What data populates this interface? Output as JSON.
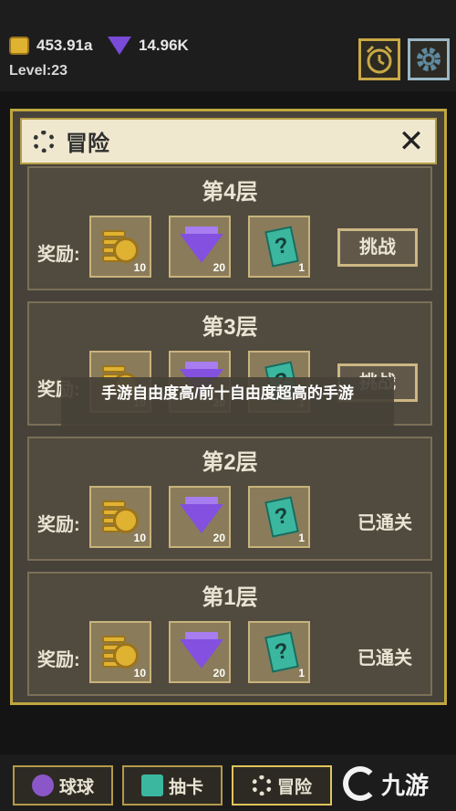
{
  "top": {
    "coins": "453.91a",
    "gems": "14.96K",
    "level": "Level:23"
  },
  "dialog": {
    "title": "冒险",
    "reward_label": "奖励:",
    "floors": [
      {
        "title": "第4层",
        "rewards": {
          "coins": "10",
          "gems": "20",
          "cards": "1"
        },
        "action": "挑战"
      },
      {
        "title": "第3层",
        "rewards": {
          "coins": "10",
          "gems": "20",
          "cards": "1"
        },
        "action": "挑战"
      },
      {
        "title": "第2层",
        "rewards": {
          "coins": "10",
          "gems": "20",
          "cards": "1"
        },
        "status": "已通关"
      },
      {
        "title": "第1层",
        "rewards": {
          "coins": "10",
          "gems": "20",
          "cards": "1"
        },
        "status": "已通关"
      }
    ]
  },
  "banner": "手游自由度高/前十自由度超高的手游",
  "tabs": {
    "ball": "球球",
    "draw": "抽卡",
    "adventure": "冒险"
  },
  "watermark": "九游",
  "colors": {
    "gold": "#c0a640",
    "panel": "#514a3e",
    "gem": "#8350e0",
    "card": "#3bb7a0"
  }
}
